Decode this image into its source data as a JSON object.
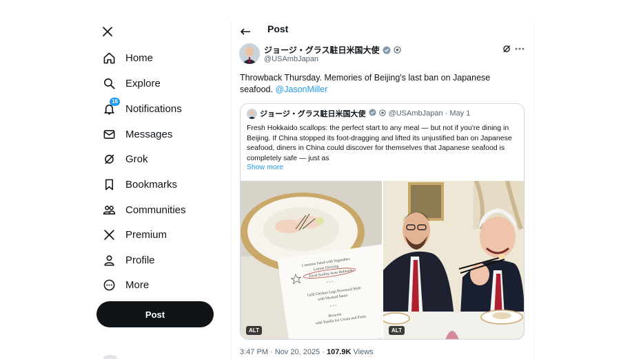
{
  "sidebar": {
    "logo": "x-logo-icon",
    "items": [
      {
        "label": "Home",
        "icon": "home-icon"
      },
      {
        "label": "Explore",
        "icon": "search-icon"
      },
      {
        "label": "Notifications",
        "icon": "bell-icon",
        "badge": "16"
      },
      {
        "label": "Messages",
        "icon": "envelope-icon"
      },
      {
        "label": "Grok",
        "icon": "grok-icon"
      },
      {
        "label": "Bookmarks",
        "icon": "bookmark-icon"
      },
      {
        "label": "Communities",
        "icon": "people-icon"
      },
      {
        "label": "Premium",
        "icon": "x-icon"
      },
      {
        "label": "Profile",
        "icon": "person-icon"
      },
      {
        "label": "More",
        "icon": "more-circle-icon"
      }
    ],
    "post_button": "Post"
  },
  "header": {
    "title": "Post"
  },
  "tweet": {
    "author_name": "ジョージ・グラス駐日米国大使",
    "handle": "@USAmbJapan",
    "text": "Throwback Thursday. Memories of Beijing's last ban on Japanese seafood.",
    "mention": "@JasonMiller",
    "time": "3:47 PM · Nov 20, 2025 · ",
    "views_count": "107.9K",
    "views_label": " Views"
  },
  "quote": {
    "author_name": "ジョージ・グラス駐日米国大使",
    "handle_date": "@USAmbJapan · May 1",
    "text": "Fresh Hokkaido scallops: the perfect start to any meal — but not if you're dining in Beijing. If China stopped its foot-dragging and lifted its unjustified ban on Japanese seafood, diners in China could discover for themselves that Japanese seafood is completely safe — just as",
    "show_more": "Show more",
    "media": [
      {
        "alt": "ALT"
      },
      {
        "alt": "ALT"
      }
    ]
  },
  "colors": {
    "accent": "#1d9bf0",
    "text": "#0f1419",
    "muted": "#536471",
    "border": "#cfd9de"
  }
}
